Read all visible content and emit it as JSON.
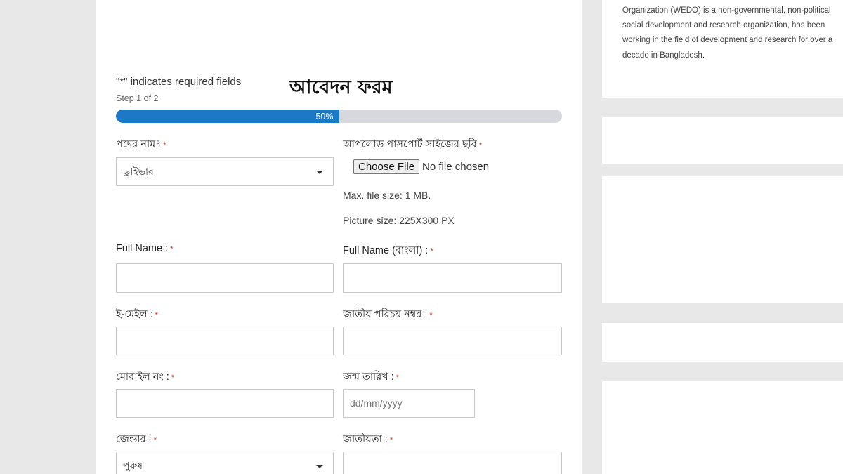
{
  "sidebar": {
    "about_text": "Organization (WEDO) is a non-governmental, non-political social development and research organization, has been working in the field of development and research for over a decade in Bangladesh."
  },
  "form": {
    "required_note": "\"*\" indicates required fields",
    "title": "আবেদন ফরম",
    "step_text": "Step 1 of 2",
    "progress": {
      "percent": 50,
      "label": "50%"
    },
    "required_marker": "*",
    "fields": {
      "post_name": {
        "label": "পদের নামঃ",
        "value": "ড্রাইভার"
      },
      "photo_upload": {
        "label": "আপলোড পাসপোর্ট সাইজের ছবি",
        "button_label": "Choose File",
        "status": "No file chosen",
        "hint_size": "Max. file size: 1 MB.",
        "hint_picture": "Picture size: 225X300 PX"
      },
      "full_name": {
        "label": "Full Name :"
      },
      "full_name_bn": {
        "label": "Full Name (বাংলা) :"
      },
      "email": {
        "label": "ই-মেইল :"
      },
      "nid": {
        "label": "জাতীয় পরিচয় নম্বর :"
      },
      "mobile": {
        "label": "মোবাইল নং :"
      },
      "dob": {
        "label": "জন্ম তারিখ :",
        "placeholder": "dd/mm/yyyy"
      },
      "gender": {
        "label": "জেন্ডার :",
        "value": "পুরুষ"
      },
      "nationality": {
        "label": "জাতীয়তা :"
      }
    }
  },
  "colors": {
    "accent": "#1e78c8",
    "required": "#c02b0a",
    "progress_track": "#d6d8de"
  }
}
